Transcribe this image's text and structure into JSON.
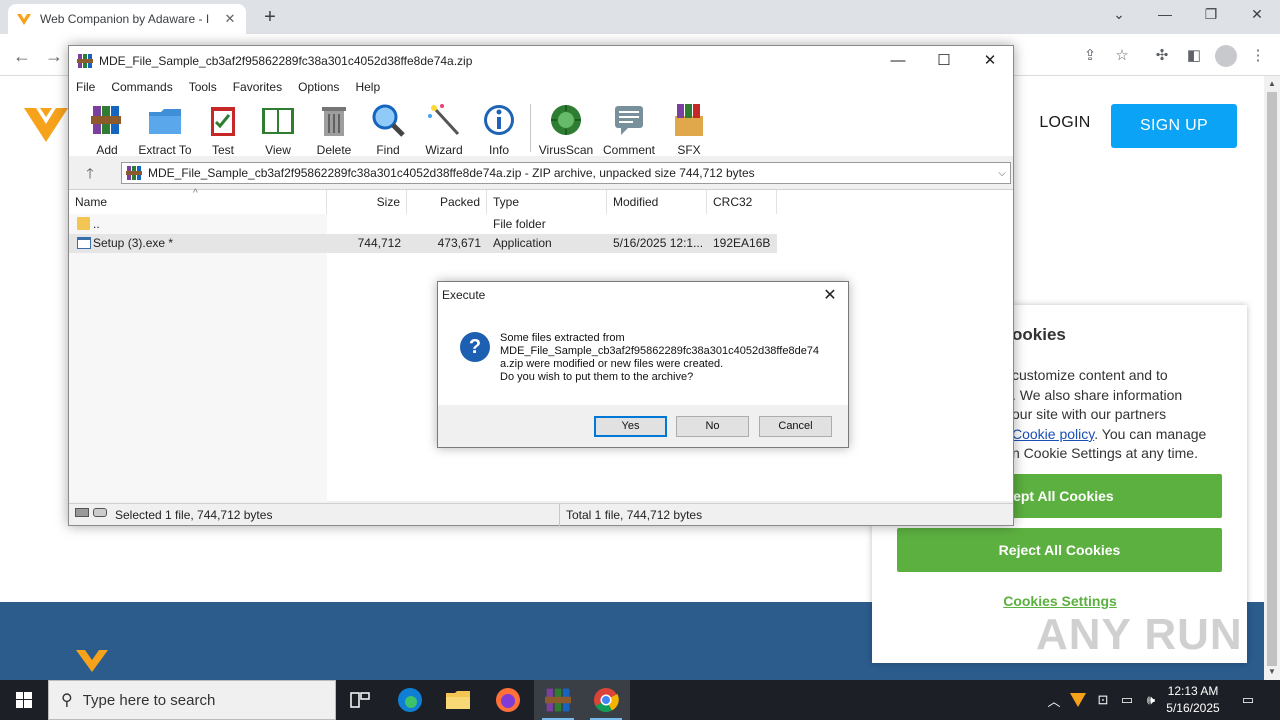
{
  "browser": {
    "tab_title": "Web Companion by Adaware - I",
    "tab_close": "✕",
    "new_tab": "+",
    "controls": {
      "minimize": "—",
      "maximize": "❐",
      "close": "✕",
      "collapse": "⌄"
    }
  },
  "website": {
    "login": "LOGIN",
    "signup": "SIGN UP",
    "cookie_title": "ookies",
    "cookie_lines": [
      " customize content and to",
      ". We also share information",
      "our site with our partners"
    ],
    "cookie_policy_link": "Cookie policy",
    "cookie_policy_after": ". You can manage",
    "cookie_last_line": "n Cookie Settings at any time.",
    "accept_button": "cept All Cookies",
    "reject_button": "Reject All Cookies",
    "settings_link": "Cookies Settings",
    "watermark": "ANY RUN"
  },
  "winrar": {
    "title": "MDE_File_Sample_cb3af2f95862289fc38a301c4052d38ffe8de74a.zip",
    "menu": [
      "File",
      "Commands",
      "Tools",
      "Favorites",
      "Options",
      "Help"
    ],
    "toolbar": [
      "Add",
      "Extract To",
      "Test",
      "View",
      "Delete",
      "Find",
      "Wizard",
      "Info",
      "VirusScan",
      "Comment",
      "SFX"
    ],
    "address": "MDE_File_Sample_cb3af2f95862289fc38a301c4052d38ffe8de74a.zip - ZIP archive, unpacked size 744,712 bytes",
    "columns": [
      "Name",
      "Size",
      "Packed",
      "Type",
      "Modified",
      "CRC32"
    ],
    "rows": [
      {
        "name": "..",
        "size": "",
        "packed": "",
        "type": "File folder",
        "modified": "",
        "crc": ""
      },
      {
        "name": "Setup (3).exe *",
        "size": "744,712",
        "packed": "473,671",
        "type": "Application",
        "modified": "5/16/2025 12:1...",
        "crc": "192EA16B"
      }
    ],
    "status_left": "Selected 1 file, 744,712 bytes",
    "status_right": "Total 1 file, 744,712 bytes"
  },
  "dialog": {
    "title": "Execute",
    "message_lines": [
      "Some files extracted from",
      "MDE_File_Sample_cb3af2f95862289fc38a301c4052d38ffe8de74",
      "a.zip were modified or new files were created.",
      "Do you wish to put them to the archive?"
    ],
    "yes": "Yes",
    "no": "No",
    "cancel": "Cancel",
    "icon": "?"
  },
  "taskbar": {
    "search_placeholder": "Type here to search",
    "time": "12:13 AM",
    "date": "5/16/2025"
  },
  "colors": {
    "accent": "#0aa3f5",
    "cookie_green": "#5cb040",
    "footer": "#2b5c8c",
    "taskbar": "#1c2026"
  }
}
